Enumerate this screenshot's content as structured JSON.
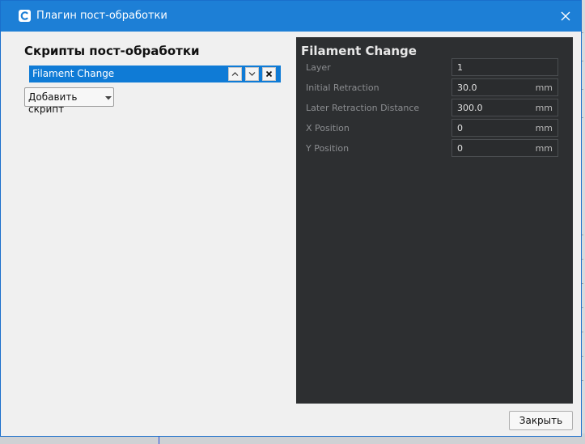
{
  "window": {
    "title": "Плагин пост-обработки"
  },
  "left_panel": {
    "title": "Скрипты пост-обработки",
    "scripts": [
      {
        "label": "Filament Change",
        "selected": true
      }
    ],
    "add_script_label": "Добавить скрипт"
  },
  "right_panel": {
    "title": "Filament Change",
    "settings": [
      {
        "label": "Layer",
        "value": "1",
        "unit": ""
      },
      {
        "label": "Initial Retraction",
        "value": "30.0",
        "unit": "mm"
      },
      {
        "label": "Later Retraction Distance",
        "value": "300.0",
        "unit": "mm"
      },
      {
        "label": "X Position",
        "value": "0",
        "unit": "mm"
      },
      {
        "label": "Y Position",
        "value": "0",
        "unit": "mm"
      }
    ]
  },
  "footer": {
    "close_label": "Закрыть"
  },
  "icons": {
    "app": "cura-logo-icon",
    "window_close": "close-icon",
    "move_up": "chevron-up-icon",
    "move_down": "chevron-down-icon",
    "remove": "close-icon",
    "dropdown": "caret-down-icon"
  },
  "colors": {
    "titlebar": "#1d7fd6",
    "selection": "#0f7bd6",
    "dark_panel": "#2d2f31"
  }
}
